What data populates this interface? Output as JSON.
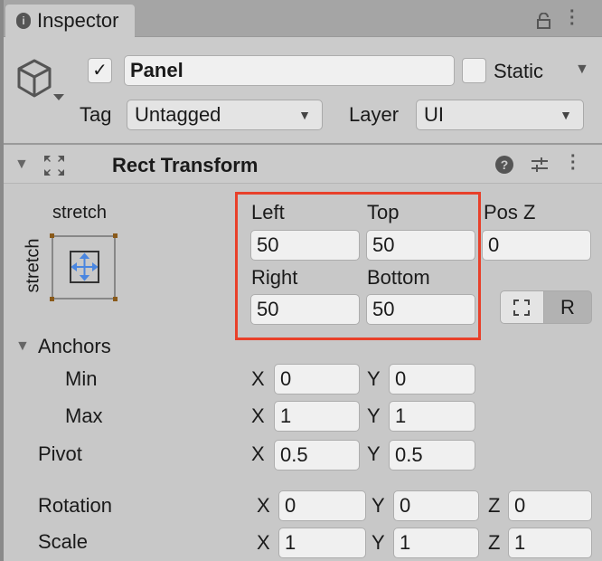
{
  "window": {
    "tab_title": "Inspector",
    "info_icon": "info-icon",
    "lock_icon": "lock-icon",
    "menu_icon": "kebab-menu-icon"
  },
  "object": {
    "active": true,
    "name": "Panel",
    "static_label": "Static",
    "static": false,
    "tag_label": "Tag",
    "tag_value": "Untagged",
    "layer_label": "Layer",
    "layer_value": "UI"
  },
  "rect_transform": {
    "title": "Rect Transform",
    "anchor_preset_h": "stretch",
    "anchor_preset_v": "stretch",
    "left_label": "Left",
    "left": "50",
    "top_label": "Top",
    "top": "50",
    "posz_label": "Pos Z",
    "posz": "0",
    "right_label": "Right",
    "right": "50",
    "bottom_label": "Bottom",
    "bottom": "50",
    "raw_button": "R",
    "anchors_label": "Anchors",
    "min_label": "Min",
    "max_label": "Max",
    "x": "X",
    "y": "Y",
    "z": "Z",
    "min_x": "0",
    "min_y": "0",
    "max_x": "1",
    "max_y": "1",
    "pivot_label": "Pivot",
    "pivot_x": "0.5",
    "pivot_y": "0.5",
    "rotation_label": "Rotation",
    "rot_x": "0",
    "rot_y": "0",
    "rot_z": "0",
    "scale_label": "Scale",
    "scale_x": "1",
    "scale_y": "1",
    "scale_z": "1"
  },
  "colors": {
    "highlight": "#e8402a",
    "anchor_arrows": "#4a86e0"
  }
}
